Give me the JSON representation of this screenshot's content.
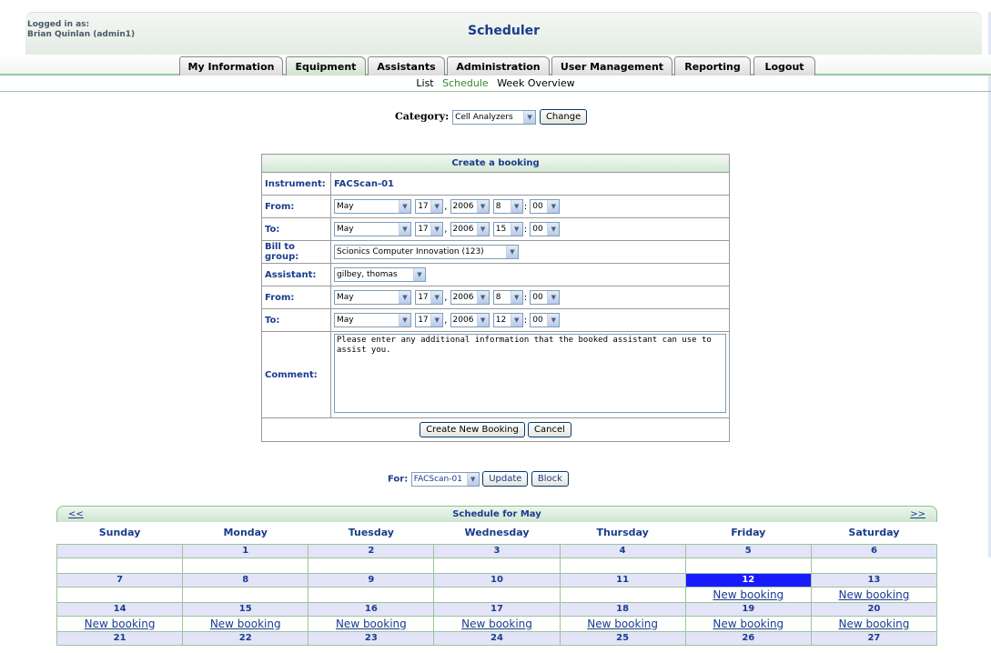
{
  "header": {
    "login_line1": "Logged in as:",
    "login_line2": "Brian Quinlan (admin1)",
    "title": "Scheduler"
  },
  "tabs": [
    "My Information",
    "Equipment",
    "Assistants",
    "Administration",
    "User Management",
    "Reporting",
    "Logout"
  ],
  "subnav": {
    "list": "List",
    "schedule": "Schedule",
    "week": "Week Overview"
  },
  "category": {
    "label": "Category:",
    "value": "Cell Analyzers",
    "button": "Change"
  },
  "form": {
    "title": "Create a booking",
    "instrument_label": "Instrument:",
    "instrument_value": "FACScan-01",
    "from_label": "From:",
    "to_label": "To:",
    "bill_label": "Bill to group:",
    "bill_value": "Scionics Computer Innovation (123)",
    "assistant_label": "Assistant:",
    "assistant_value": "gilbey, thomas",
    "comment_label": "Comment:",
    "comment_value": "Please enter any additional information that the booked assistant can use to assist you.",
    "rows": [
      {
        "month": "May",
        "day": "17",
        "year": "2006",
        "hour": "8",
        "min": "00"
      },
      {
        "month": "May",
        "day": "17",
        "year": "2006",
        "hour": "15",
        "min": "00"
      },
      {
        "month": "May",
        "day": "17",
        "year": "2006",
        "hour": "8",
        "min": "00"
      },
      {
        "month": "May",
        "day": "17",
        "year": "2006",
        "hour": "12",
        "min": "00"
      }
    ],
    "create_button": "Create New Booking",
    "cancel_button": "Cancel"
  },
  "for_row": {
    "label": "For:",
    "value": "FACScan-01",
    "update": "Update",
    "block": "Block"
  },
  "calendar": {
    "title": "Schedule for May",
    "prev": "<<",
    "next": ">>",
    "days": [
      "Sunday",
      "Monday",
      "Tuesday",
      "Wednesday",
      "Thursday",
      "Friday",
      "Saturday"
    ],
    "new_booking": "New booking",
    "weeks": [
      [
        "",
        "1",
        "2",
        "3",
        "4",
        "5",
        "6"
      ],
      [
        "7",
        "8",
        "9",
        "10",
        "11",
        "12",
        "13"
      ],
      [
        "14",
        "15",
        "16",
        "17",
        "18",
        "19",
        "20"
      ],
      [
        "21",
        "22",
        "23",
        "24",
        "25",
        "26",
        "27"
      ]
    ]
  },
  "colors": {
    "accent": "#1a3c8c",
    "today": "#1a1aff",
    "border_green": "#9cc49c"
  }
}
